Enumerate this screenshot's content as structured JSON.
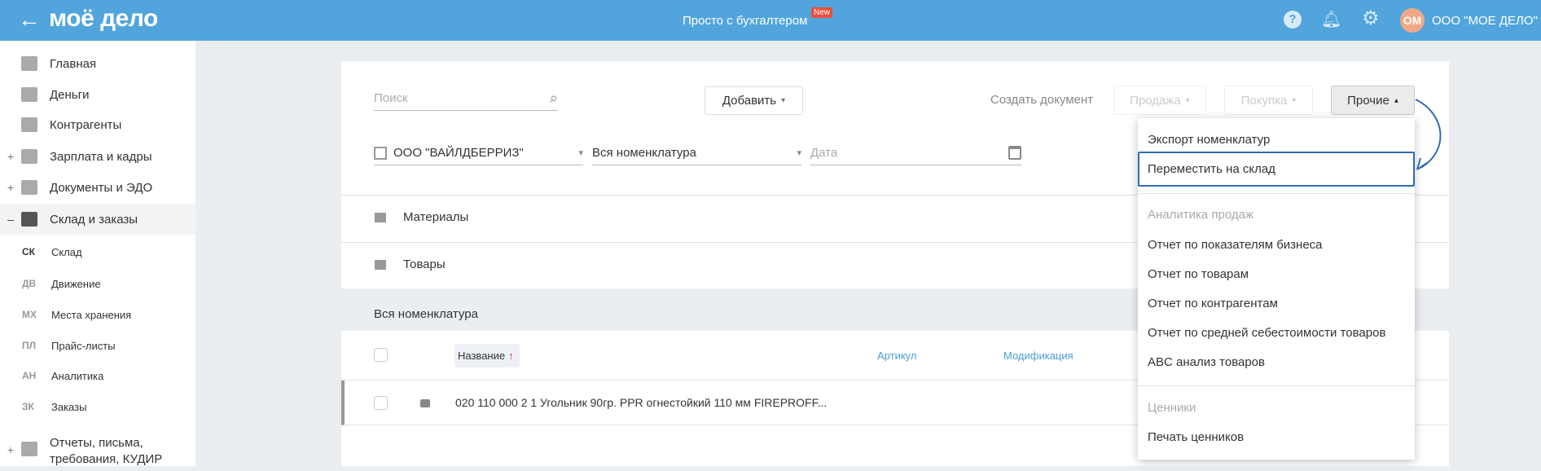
{
  "header": {
    "logo": "моё дело",
    "center_title": "Просто с бухгалтером",
    "new_badge": "New",
    "avatar_initials": "ОМ",
    "company": "ООО \"МОЕ ДЕЛО\"",
    "accent": "#52a5dc"
  },
  "sidebar": {
    "items": [
      {
        "label": "Главная",
        "icon": "home-icon",
        "toggle": ""
      },
      {
        "label": "Деньги",
        "icon": "money-icon",
        "toggle": ""
      },
      {
        "label": "Контрагенты",
        "icon": "person-icon",
        "toggle": ""
      },
      {
        "label": "Зарплата и кадры",
        "icon": "wallet-icon",
        "toggle": "+"
      },
      {
        "label": "Документы и ЭДО",
        "icon": "folder-icon",
        "toggle": "+"
      },
      {
        "label": "Склад и заказы",
        "icon": "warehouse-icon",
        "toggle": "–"
      }
    ],
    "subitems": [
      {
        "abbr": "СК",
        "label": "Склад"
      },
      {
        "abbr": "ДВ",
        "label": "Движение"
      },
      {
        "abbr": "МХ",
        "label": "Места хранения"
      },
      {
        "abbr": "ПЛ",
        "label": "Прайс-листы"
      },
      {
        "abbr": "АН",
        "label": "Аналитика"
      },
      {
        "abbr": "ЗК",
        "label": "Заказы"
      }
    ],
    "reports": {
      "label": "Отчеты, письма, требования, КУДИР",
      "toggle": "+"
    }
  },
  "toolbar": {
    "search_placeholder": "Поиск",
    "add_label": "Добавить",
    "create_doc_label": "Создать документ",
    "sale_label": "Продажа",
    "purchase_label": "Покупка",
    "other_label": "Прочие"
  },
  "filters": {
    "org": "ООО \"ВАЙЛДБЕРРИЗ\"",
    "nomenclature": "Вся номенклатура",
    "date_placeholder": "Дата"
  },
  "folders": [
    "Материалы",
    "Товары"
  ],
  "section_title": "Вся номенклатура",
  "table": {
    "columns": [
      "Название",
      "Артикул",
      "Модификация"
    ],
    "sort_indicator": "↑",
    "rows": [
      {
        "name": "020 110 000 2 1 Угольник 90гр. PPR огнестойкий 110 мм FIREPROFF..."
      }
    ]
  },
  "dropdown": {
    "items": [
      "Экспорт номенклатур",
      "Переместить на склад"
    ],
    "group1_title": "Аналитика продаж",
    "group1": [
      "Отчет по показателям бизнеса",
      "Отчет по товарам",
      "Отчет по контрагентам",
      "Отчет по средней себестоимости товаров",
      "ABC анализ товаров"
    ],
    "group2_title": "Ценники",
    "group2": [
      "Печать ценников"
    ],
    "highlight_color": "#2f6db5"
  }
}
